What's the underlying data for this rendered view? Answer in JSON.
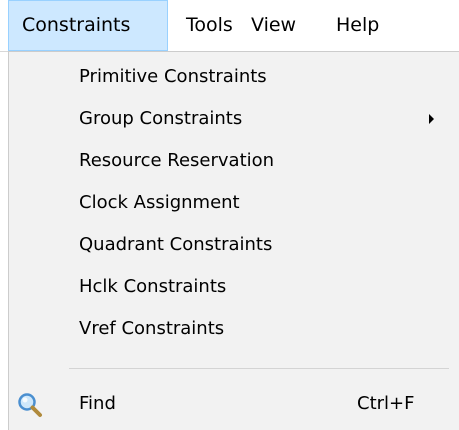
{
  "menubar": {
    "items": [
      {
        "label": "Constraints"
      },
      {
        "label": "Tools"
      },
      {
        "label": "View"
      },
      {
        "label": "Help"
      }
    ]
  },
  "dropdown": {
    "items": [
      {
        "label": "Primitive Constraints"
      },
      {
        "label": "Group Constraints",
        "has_submenu": true
      },
      {
        "label": "Resource Reservation"
      },
      {
        "label": "Clock Assignment"
      },
      {
        "label": "Quadrant Constraints"
      },
      {
        "label": "Hclk Constraints"
      },
      {
        "label": "Vref Constraints"
      }
    ],
    "find": {
      "label": "Find",
      "shortcut": "Ctrl+F",
      "icon": "magnifier-icon"
    }
  },
  "colors": {
    "open_menu_highlight": "#cde8ff",
    "open_menu_border": "#99d1ff",
    "dropdown_background": "#f2f2f2"
  }
}
